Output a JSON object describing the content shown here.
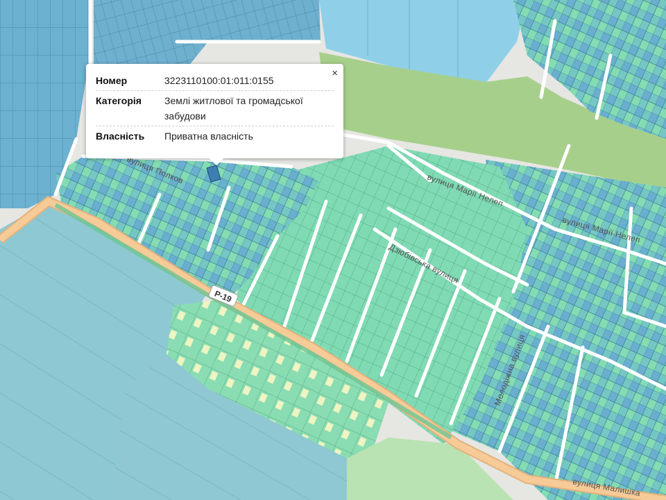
{
  "popup": {
    "close_glyph": "×",
    "rows": [
      {
        "key": "Номер",
        "value": "3223110100:01:011:0155"
      },
      {
        "key": "Категорія",
        "value": "Землі житлової та громадської забудови"
      },
      {
        "key": "Власність",
        "value": "Приватна власність"
      }
    ]
  },
  "streets": [
    {
      "name": "вулиця Марії Нелеп"
    },
    {
      "name": "вулиця Марії Нелеп"
    },
    {
      "name": "Дзюбівська вулиця"
    },
    {
      "name": "Молодіжна вулиця"
    },
    {
      "name": "вулиця Малишка"
    },
    {
      "name": "вулиця Полков"
    }
  ],
  "road_shield": "Р-19",
  "colors": {
    "parcel_blue": "#6fb0cf",
    "parcel_green": "#7fdcb5",
    "parcel_yellow": "#f3f4c6",
    "park": "#a8d08d",
    "water": "#9ad0e6",
    "road_main": "#f2c48f",
    "road_minor": "#ffffff",
    "background": "#e6e6e3"
  }
}
